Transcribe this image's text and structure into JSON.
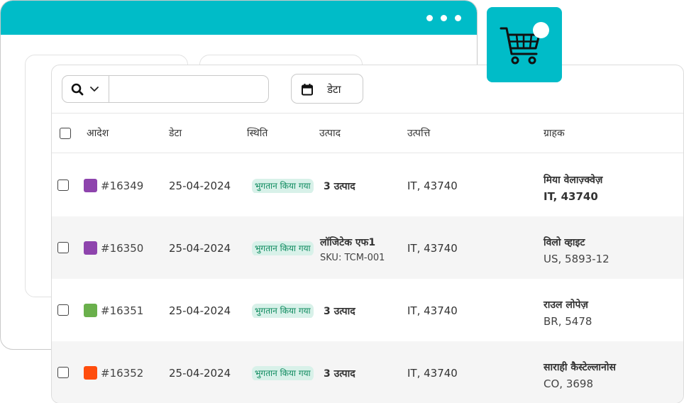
{
  "toolbar": {
    "search_placeholder": "",
    "date_button_label": "डेटा"
  },
  "table": {
    "headers": {
      "order": "आदेश",
      "date": "डेटा",
      "status": "स्थिति",
      "product": "उत्पाद",
      "origin": "उत्पत्ति",
      "customer": "ग्राहक"
    },
    "rows": [
      {
        "order_no": "#16349",
        "color": "#8e44ad",
        "date": "25-04-2024",
        "status": "भुगतान किया गया",
        "product": "3 उत्पाद",
        "sku": "",
        "origin": "IT, 43740",
        "customer_name": "मिया वेलाज़्क्वेज़",
        "customer_location": "IT, 43740"
      },
      {
        "order_no": "#16350",
        "color": "#8e44ad",
        "date": "25-04-2024",
        "status": "भुगतान किया गया",
        "product": "लॉजिटेक एफ1",
        "sku": "SKU: TCM-001",
        "origin": "IT, 43740",
        "customer_name": "विलो व्हाइट",
        "customer_location": "US, 5893-12"
      },
      {
        "order_no": "#16351",
        "color": "#6ab04c",
        "date": "25-04-2024",
        "status": "भुगतान किया गया",
        "product": "3 उत्पाद",
        "sku": "",
        "origin": "IT, 43740",
        "customer_name": "राउल लोपेज़",
        "customer_location": "BR, 5478"
      },
      {
        "order_no": "#16352",
        "color": "#ff4d0d",
        "date": "25-04-2024",
        "status": "भुगतान किया गया",
        "product": "3 उत्पाद",
        "sku": "",
        "origin": "IT, 43740",
        "customer_name": "साराही कैस्टेल्लानोस",
        "customer_location": "CO, 3698"
      }
    ]
  },
  "icons": {
    "search": "search-icon",
    "chevron": "chevron-down-icon",
    "calendar": "calendar-icon",
    "cart": "shopping-cart-icon"
  },
  "colors": {
    "accent": "#00bcc8",
    "status_bg": "#d8f1e9",
    "status_text": "#0e8a5e"
  }
}
